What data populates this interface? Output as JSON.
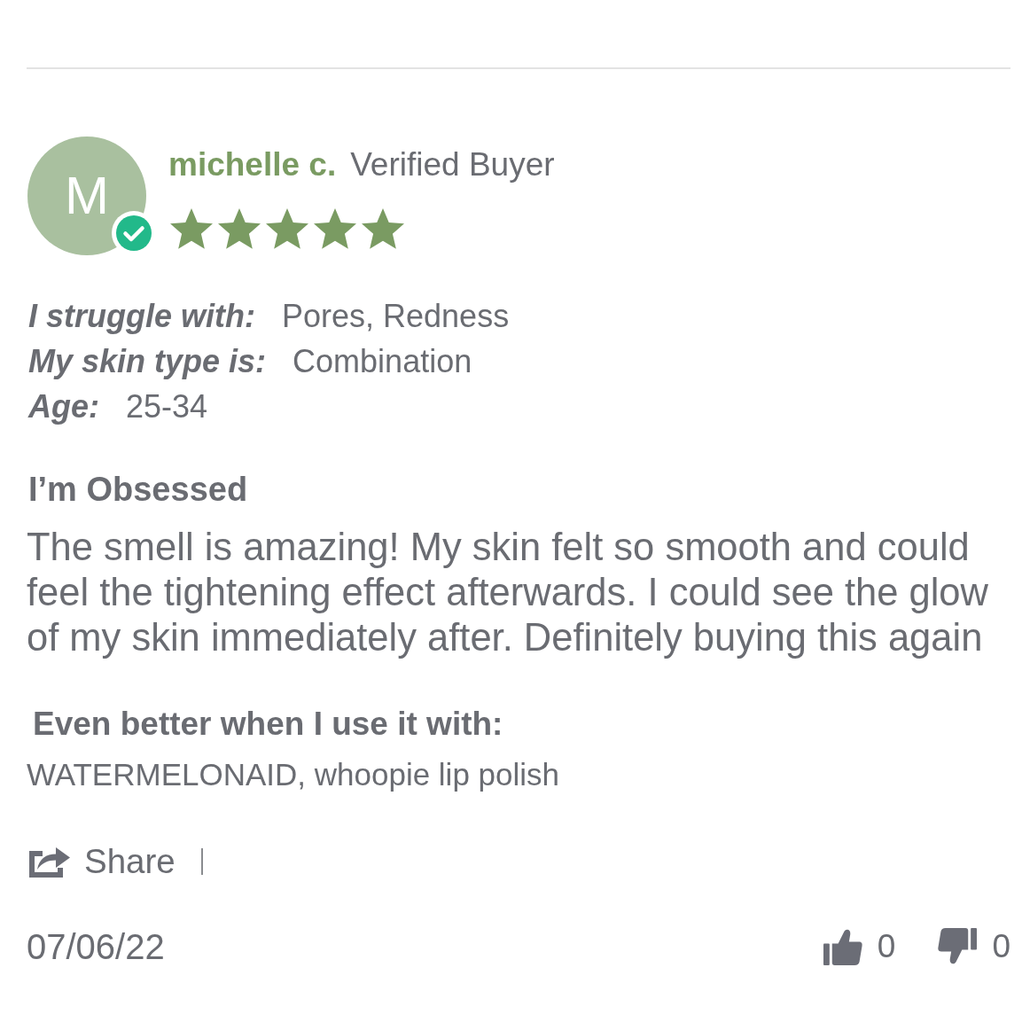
{
  "review": {
    "avatar_initial": "M",
    "verified": true,
    "author": "michelle c.",
    "buyer_label": "Verified Buyer",
    "stars": 5,
    "attributes": [
      {
        "label": "I struggle with:",
        "value": "Pores, Redness"
      },
      {
        "label": "My skin type is:",
        "value": "Combination"
      },
      {
        "label": "Age:",
        "value": "25-34"
      }
    ],
    "title": "I’m Obsessed",
    "body": "The smell is amazing! My skin felt so smooth and could feel the tightening effect afterwards. I could see the glow of my skin immediately after. Definitely buying this again",
    "pairing": {
      "heading": "Even better when I use it with:",
      "products": "WATERMELONAID, whoopie lip polish"
    },
    "share": {
      "label": "Share"
    },
    "date": "07/06/22",
    "votes": {
      "up": "0",
      "down": "0"
    }
  }
}
